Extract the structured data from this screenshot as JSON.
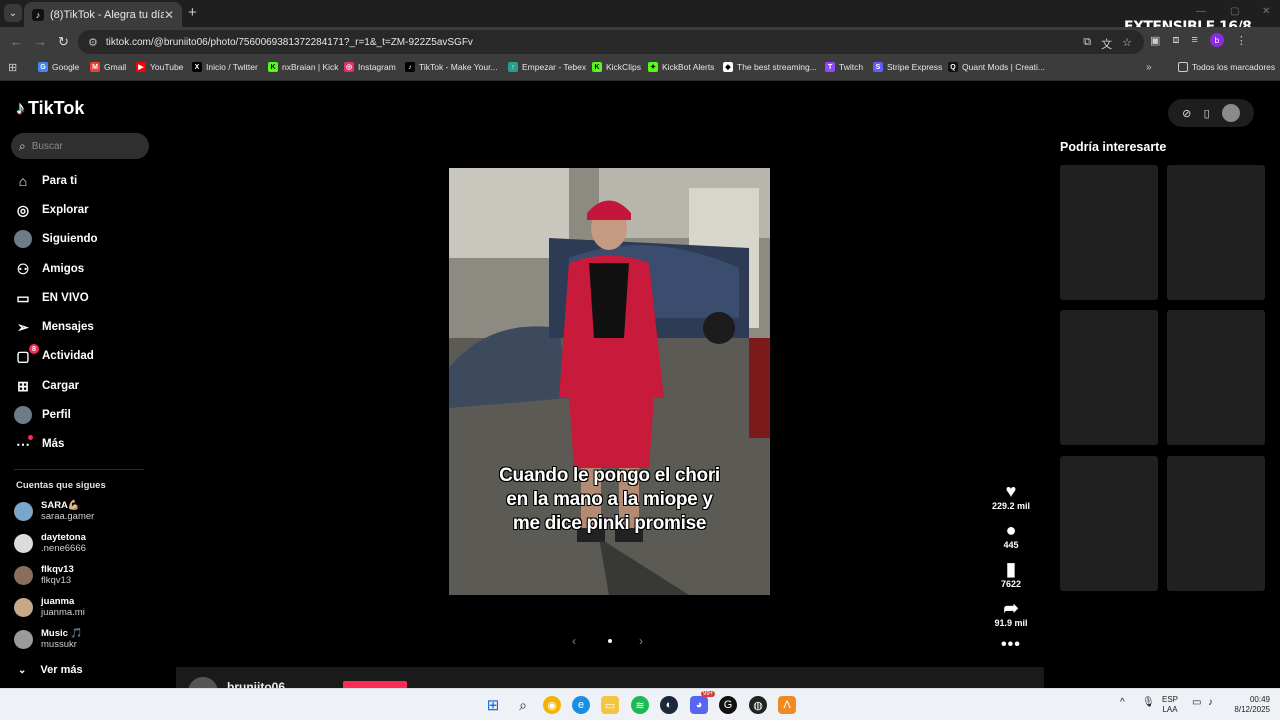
{
  "browser": {
    "tab_title": "(8)TikTok - Alegra tu día",
    "tab_close": "✕",
    "new_tab": "+",
    "url": "tiktok.com/@bruniito06/photo/7560069381372284171?_r=1&_t=ZM-922Z5avSGFv",
    "extension_label": "EXTENSIBLE 16/8",
    "profile_letter": "b",
    "bookmarks": [
      {
        "label": "Google",
        "icon": "google-icon",
        "color": "#4285f4",
        "glyph": "G"
      },
      {
        "label": "Gmail",
        "icon": "gmail-icon",
        "color": "#ea4335",
        "glyph": "M"
      },
      {
        "label": "YouTube",
        "icon": "youtube-icon",
        "color": "#ff0000",
        "glyph": "▶"
      },
      {
        "label": "Inicio / Twitter",
        "icon": "x-icon",
        "color": "#000000",
        "glyph": "X"
      },
      {
        "label": "nxBraian | Kick",
        "icon": "kick-icon",
        "color": "#53fc18",
        "glyph": "K"
      },
      {
        "label": "Instagram",
        "icon": "instagram-icon",
        "color": "#e1306c",
        "glyph": "◎"
      },
      {
        "label": "TikTok - Make Your...",
        "icon": "tiktok-icon",
        "color": "#000000",
        "glyph": "♪"
      },
      {
        "label": "Empezar - Tebex",
        "icon": "tebex-icon",
        "color": "#2a9d8f",
        "glyph": "↑"
      },
      {
        "label": "KickClips",
        "icon": "kick-icon",
        "color": "#53fc18",
        "glyph": "K"
      },
      {
        "label": "KickBot Alerts",
        "icon": "kickbot-icon",
        "color": "#53fc18",
        "glyph": "✦"
      },
      {
        "label": "The best streaming...",
        "icon": "streaming-icon",
        "color": "#ffffff",
        "glyph": "◆"
      },
      {
        "label": "Twitch",
        "icon": "twitch-icon",
        "color": "#9146ff",
        "glyph": "T"
      },
      {
        "label": "Stripe Express",
        "icon": "stripe-icon",
        "color": "#635bff",
        "glyph": "S"
      },
      {
        "label": "Quant Mods | Creati...",
        "icon": "quant-icon",
        "color": "#111111",
        "glyph": "Q"
      }
    ],
    "bookmarks_more": "»",
    "all_bookmarks": "Todos los marcadores"
  },
  "tiktok": {
    "logo": "TikTok",
    "search_placeholder": "Buscar",
    "nav": [
      {
        "label": "Para ti",
        "icon": "home-icon",
        "glyph": "⌂"
      },
      {
        "label": "Explorar",
        "icon": "compass-icon",
        "glyph": "◎"
      },
      {
        "label": "Siguiendo",
        "icon": "following-avatar-icon",
        "glyph": "●"
      },
      {
        "label": "Amigos",
        "icon": "friends-icon",
        "glyph": "⚇"
      },
      {
        "label": "EN VIVO",
        "icon": "live-tv-icon",
        "glyph": "▭"
      },
      {
        "label": "Mensajes",
        "icon": "send-icon",
        "glyph": "➢"
      },
      {
        "label": "Actividad",
        "icon": "activity-icon",
        "glyph": "▢"
      },
      {
        "label": "Cargar",
        "icon": "upload-icon",
        "glyph": "⊞"
      },
      {
        "label": "Perfil",
        "icon": "profile-avatar-icon",
        "glyph": "●"
      },
      {
        "label": "Más",
        "icon": "more-icon",
        "glyph": "⋯"
      }
    ],
    "activity_badge": "8",
    "following_title": "Cuentas que sigues",
    "following": [
      {
        "name": "SARA💪🏼",
        "username": "saraa.gamer",
        "color": "#7aa6c9"
      },
      {
        "name": "daytetona",
        "username": ".nene6666",
        "color": "#dcdcdc"
      },
      {
        "name": "flkqv13",
        "username": "flkqv13",
        "color": "#8a6d5a"
      },
      {
        "name": "juanma",
        "username": "juanma.mi",
        "color": "#c9a88a"
      },
      {
        "name": "Music 🎵",
        "username": "mussukr",
        "color": "#9a9a9a"
      }
    ],
    "see_more": "Ver más",
    "post": {
      "caption_lines": [
        "Cuando le pongo el chori",
        "en la mano a la miope y",
        "me dice pinki promise"
      ],
      "likes": "229.2 mil",
      "comments": "445",
      "saves": "7622",
      "shares": "91.9 mil",
      "author": "bruniito06"
    },
    "suggest_title": "Podría interesarte"
  },
  "taskbar": {
    "lang": "ESP",
    "layout": "LAA",
    "time": "00:49",
    "date": "8/12/2025",
    "discord_badge": "99+"
  }
}
